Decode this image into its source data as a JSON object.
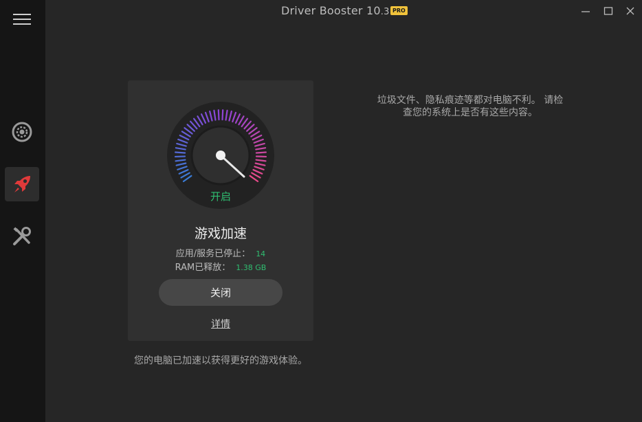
{
  "window": {
    "title": "Driver Booster 10",
    "version_suffix": ".3",
    "badge": "PRO"
  },
  "sidebar": {
    "items": [
      {
        "icon": "gear-icon",
        "active": false
      },
      {
        "icon": "rocket-icon",
        "active": true
      },
      {
        "icon": "tools-icon",
        "active": false
      }
    ]
  },
  "card": {
    "status": "开启",
    "title": "游戏加速",
    "stats": [
      {
        "label": "应用/服务已停止：",
        "value": "14"
      },
      {
        "label": "RAM已释放：",
        "value": "1.38 GB"
      }
    ],
    "close_label": "关闭",
    "details_label": "详情"
  },
  "caption": "您的电脑已加速以获得更好的游戏体验。",
  "side_message": "垃圾文件、隐私痕迹等都对电脑不利。 请检查您的系统上是否有这些内容。",
  "colors": {
    "accent_green": "#2fbf71",
    "badge_gold": "#f0c23b",
    "gauge_start": "#3a7bd5",
    "gauge_mid": "#8e44d8",
    "gauge_end": "#e84a8a"
  }
}
